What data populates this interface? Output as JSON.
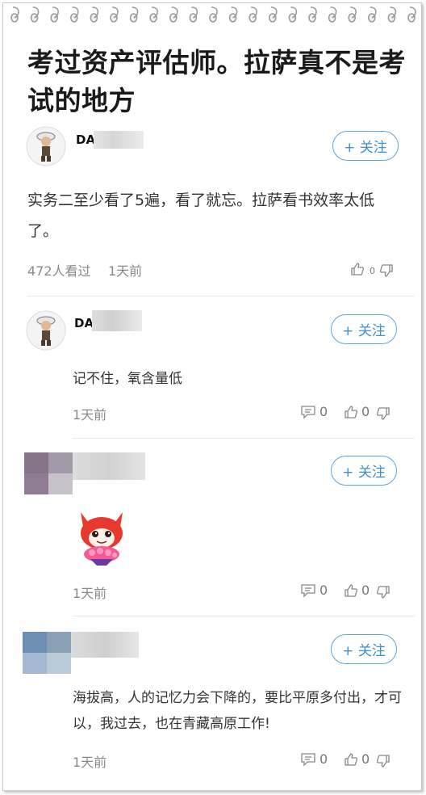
{
  "article": {
    "title": "考过资产评估师。拉萨真不是考试的地方",
    "author": "DA",
    "follow_label": "+ 关注",
    "body": "实务二至少看了5遍，看了就忘。拉萨看书效率太低了。",
    "views": "472人看过",
    "time": "1天前",
    "likes": "0"
  },
  "comments": [
    {
      "user": "DA",
      "follow_label": "+ 关注",
      "text": "记不住，氧含量低",
      "time": "1天前",
      "replies": "0",
      "likes": "0"
    },
    {
      "user": "",
      "follow_label": "+ 关注",
      "text": "",
      "time": "1天前",
      "replies": "0",
      "likes": "0"
    },
    {
      "user": "",
      "follow_label": "+ 关注",
      "text": "海拔高，人的记忆力会下降的，要比平原多付出，才可以，我过去，也在青藏高原工作!",
      "time": "1天前",
      "replies": "0",
      "likes": "0"
    }
  ],
  "colors": {
    "accent": "#3f8fd6",
    "follow_border": "#5aa7e3",
    "meta_text": "#8a8a8a"
  },
  "icons": [
    "spiral-binding",
    "avatar",
    "like-icon",
    "dislike-icon",
    "comment-icon",
    "emoji-sticker"
  ]
}
